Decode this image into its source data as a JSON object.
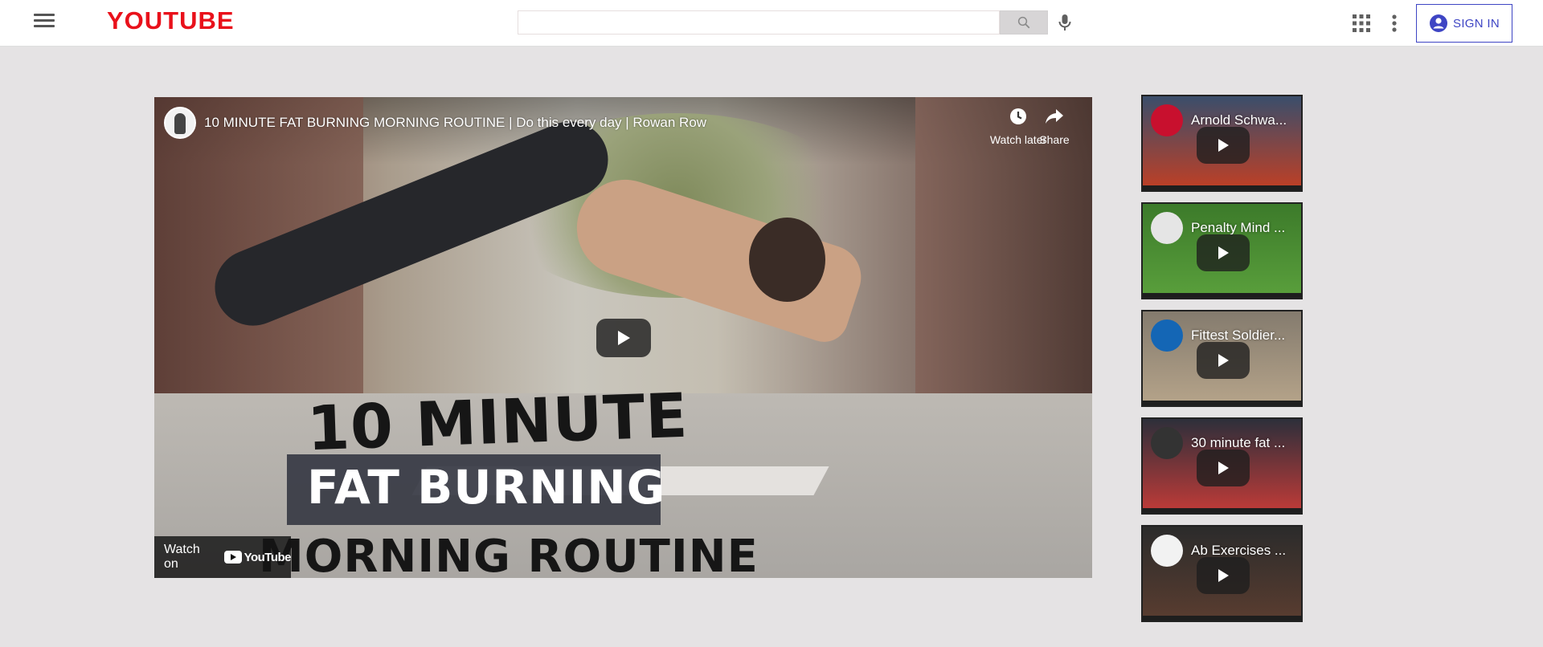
{
  "header": {
    "logo_text": "YOUTUBE",
    "logo_color": "#e9111b",
    "menu_icon": "hamburger-menu-icon",
    "search_placeholder": "",
    "search_value": "",
    "search_icon": "search-icon",
    "mic_icon": "microphone-icon",
    "apps_icon": "apps-grid-icon",
    "more_icon": "more-vertical-icon",
    "signin_label": "SIGN IN",
    "signin_color": "#3e45c4"
  },
  "player": {
    "video_title": "10 MINUTE FAT BURNING MORNING ROUTINE | Do this every day | Rowan Row",
    "watch_later_label": "Watch later",
    "share_label": "Share",
    "watch_on_label": "Watch on",
    "watch_on_brand": "YouTube",
    "thumbnail_text": {
      "line1": "10 MINUTE",
      "line2": "FAT BURNING",
      "line3": "MORNING ROUTINE"
    }
  },
  "sidebar": {
    "items": [
      {
        "title": "Arnold Schwa...",
        "avatar_color": "#c8102e",
        "bg_top": "#3a4e6b",
        "bg_bottom": "#c13f24"
      },
      {
        "title": "Penalty Mind ...",
        "avatar_color": "#e5e5e5",
        "bg_top": "#3c7a2a",
        "bg_bottom": "#5aa03c"
      },
      {
        "title": "Fittest Soldier...",
        "avatar_color": "#1466b5",
        "bg_top": "#847b6e",
        "bg_bottom": "#b6a48a"
      },
      {
        "title": "30 minute fat ...",
        "avatar_color": "#333333",
        "bg_top": "#2d2f3a",
        "bg_bottom": "#c23b38"
      },
      {
        "title": "Ab Exercises ...",
        "avatar_color": "#f2f2f2",
        "bg_top": "#2b2b2b",
        "bg_bottom": "#5a3d30"
      }
    ]
  }
}
